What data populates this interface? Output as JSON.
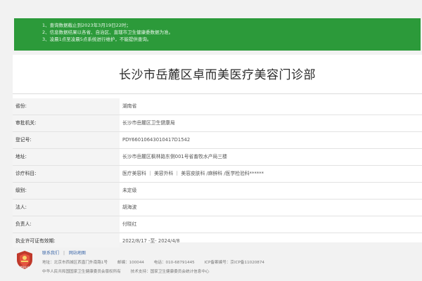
{
  "notice": {
    "lines": [
      "1、查询数据截止到2023年3月19日22时；",
      "2、信息数据结果以各省、自治区、直辖市卫生健康委数据为准。",
      "3、凌晨1点至凌晨5点系统进行维护，不能提供查询。"
    ],
    "color": "#2c9a3a"
  },
  "page": {
    "title": "长沙市岳麓区卓而美医疗美容门诊部"
  },
  "rows": [
    {
      "label": "省份:",
      "value": "湖南省"
    },
    {
      "label": "审批机关:",
      "value": "长沙市岳麓区卫生健康局"
    },
    {
      "label": "登记号:",
      "value": "PDY66010643010417D1542"
    },
    {
      "label": "地址:",
      "value": "长沙市岳麓区枫林路东侧001号省畜牧水产局三楼"
    },
    {
      "label": "诊疗科目:",
      "value": "医疗美容科 ｜ 美容外科 ｜ 美容皮肤科 /麻醉科 /医学检验科******"
    },
    {
      "label": "级别:",
      "value": "未定级"
    },
    {
      "label": "法人:",
      "value": "胡海波"
    },
    {
      "label": "负责人:",
      "value": "付晓红"
    },
    {
      "label": "执业许可证有效期:",
      "value": "2022/8/17 -至- 2024/4/8"
    }
  ],
  "footer": {
    "links": [
      "联系我们",
      "网站地图"
    ],
    "emblem_text": "党政机关",
    "address": "地址：北京市西城区西直门外南路1号",
    "postcode": "邮编：100044",
    "phone": "电话：010-68791445",
    "icp": "ICP备案编号：京ICP备11020874",
    "sponsor": "中华人民共和国国家卫生健康委员会版权所有",
    "support": "技术支持：国家卫生健康委员会统计信息中心",
    "emblem_color": "#c0392b"
  }
}
